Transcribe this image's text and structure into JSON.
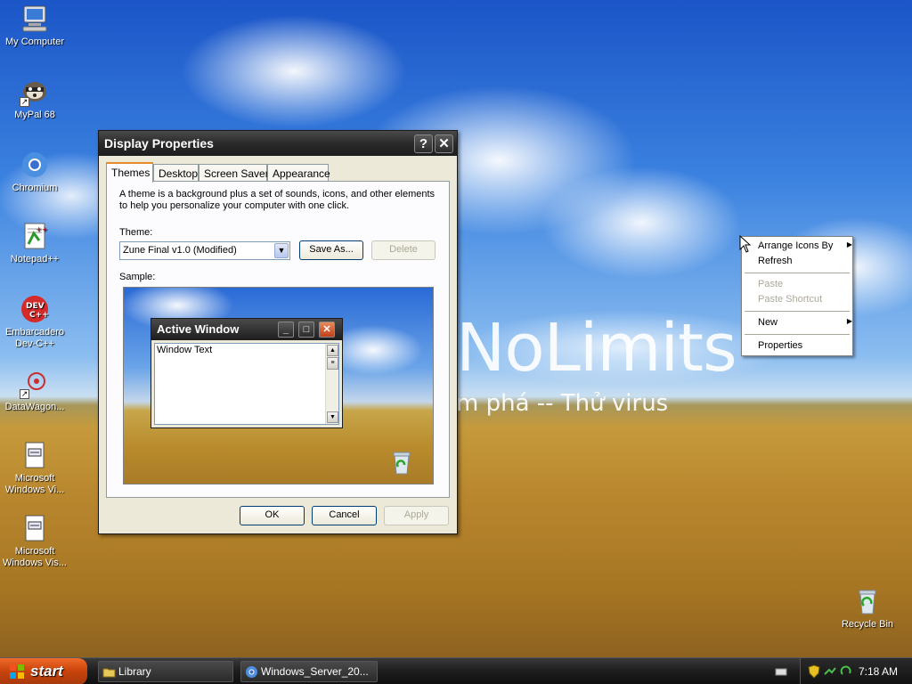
{
  "desktop": {
    "wallpaper_text": "NoLimits",
    "wallpaper_subtext": "m phá -- Thử virus",
    "icons": [
      {
        "label": "My Computer"
      },
      {
        "label": "MyPal 68"
      },
      {
        "label": "Chromium"
      },
      {
        "label": "Notepad++"
      },
      {
        "label": "Embarcadero Dev-C++"
      },
      {
        "label": "DataWagon..."
      },
      {
        "label": "Microsoft Windows Vi..."
      },
      {
        "label": "Microsoft Windows Vis..."
      },
      {
        "label": "Recycle Bin"
      }
    ]
  },
  "dialog": {
    "title": "Display Properties",
    "help_btn": "?",
    "close_btn": "✕",
    "tabs": [
      {
        "label": "Themes"
      },
      {
        "label": "Desktop"
      },
      {
        "label": "Screen Saver"
      },
      {
        "label": "Appearance"
      }
    ],
    "description": "A theme is a background plus a set of sounds, icons, and other elements to help you personalize your computer with one click.",
    "theme_label": "Theme:",
    "theme_value": "Zune Final v1.0 (Modified)",
    "save_as_label": "Save As...",
    "delete_label": "Delete",
    "sample_label": "Sample:",
    "sample": {
      "window_title": "Active Window",
      "window_text": "Window Text"
    },
    "ok_label": "OK",
    "cancel_label": "Cancel",
    "apply_label": "Apply"
  },
  "context_menu": {
    "items": [
      {
        "label": "Arrange Icons By",
        "submenu": true,
        "disabled": false
      },
      {
        "label": "Refresh",
        "submenu": false,
        "disabled": false
      },
      {
        "label": "Paste",
        "submenu": false,
        "disabled": true
      },
      {
        "label": "Paste Shortcut",
        "submenu": false,
        "disabled": true
      },
      {
        "label": "New",
        "submenu": true,
        "disabled": false
      },
      {
        "label": "Properties",
        "submenu": false,
        "disabled": false
      }
    ]
  },
  "taskbar": {
    "start_label": "start",
    "tasks": [
      {
        "label": "Library",
        "icon": "folder-icon"
      },
      {
        "label": "Windows_Server_20...",
        "icon": "chromium-icon"
      }
    ],
    "clock": "7:18 AM"
  },
  "colors": {
    "start_button": "#c8420a",
    "titlebar": "#2a2a2a",
    "tab_highlight": "#e68b2c"
  }
}
